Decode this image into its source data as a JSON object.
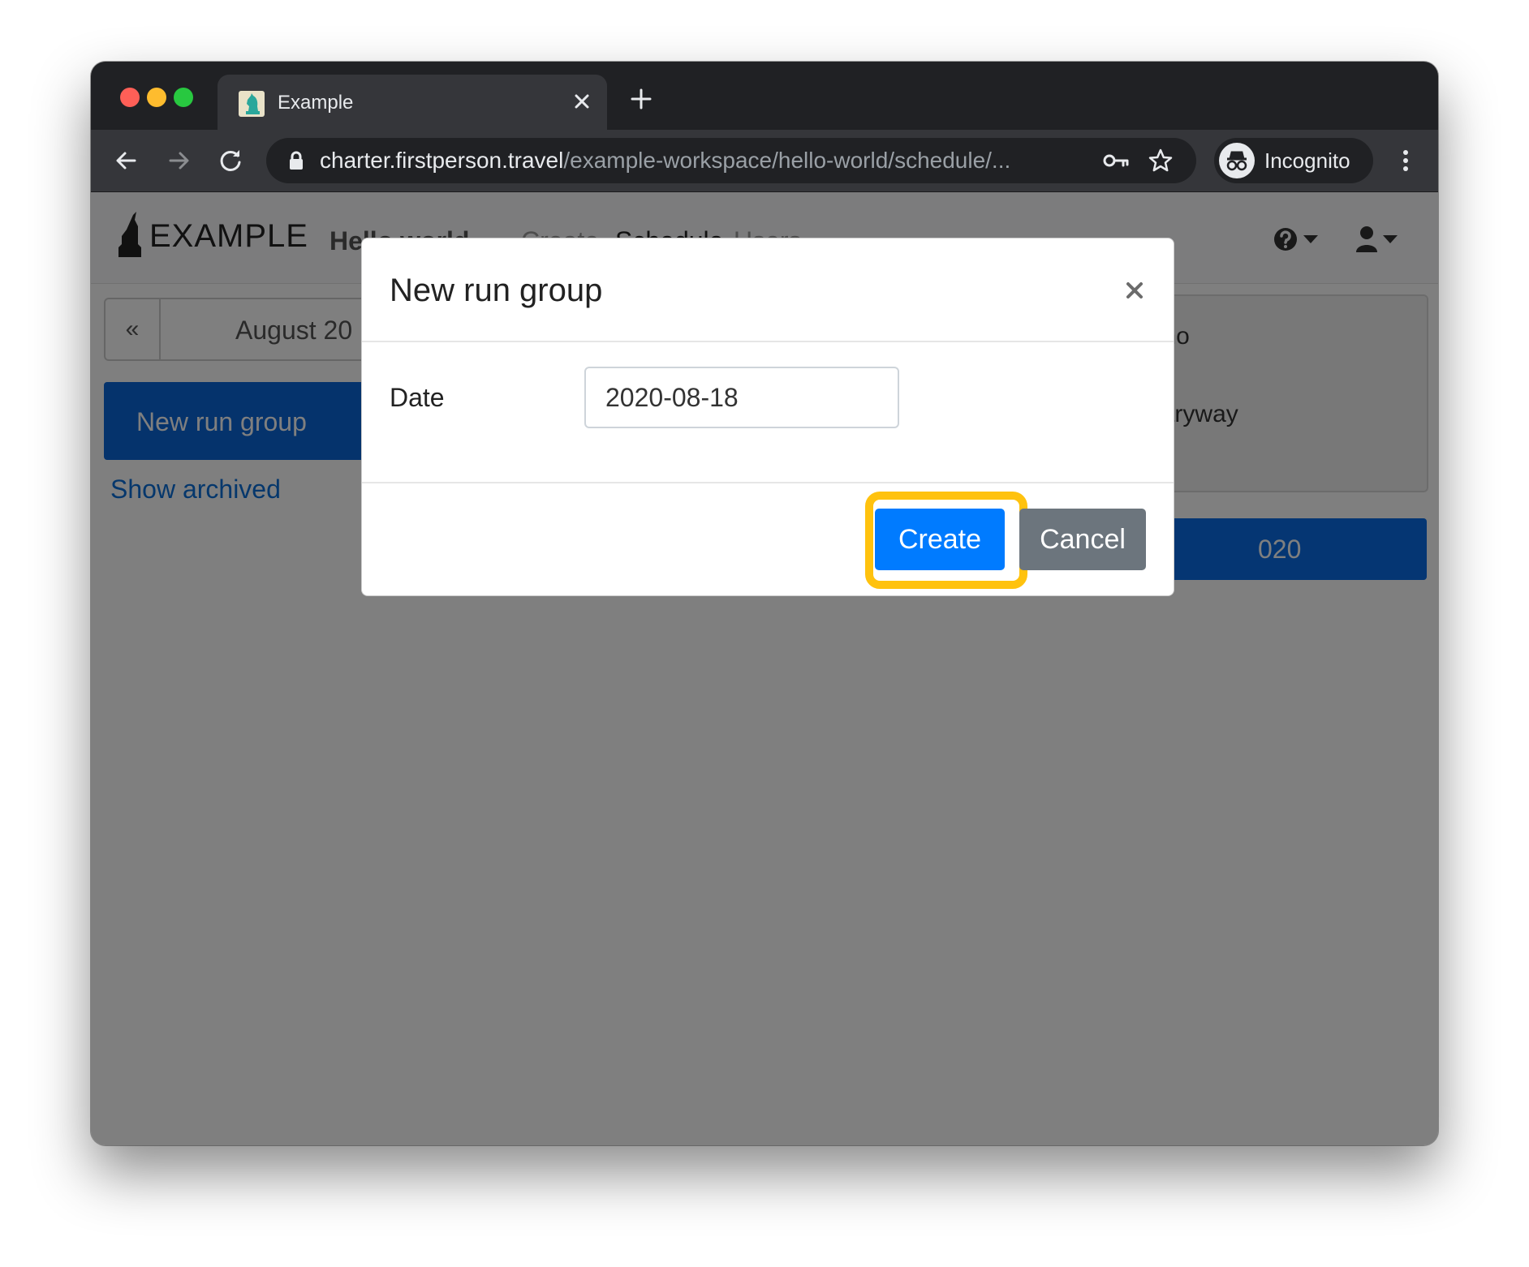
{
  "browser": {
    "tab": {
      "title": "Example",
      "favicon": "chess-knight-favicon"
    },
    "new_tab_icon": "plus-icon",
    "url": {
      "host": "charter.firstperson.travel",
      "path": "/example-workspace/hello-world/schedule/..."
    },
    "profile_label": "Incognito",
    "traffic_light_colors": {
      "close": "#ff5f57",
      "minimize": "#febc2e",
      "zoom": "#28c840"
    }
  },
  "app": {
    "brand": "EXAMPLE",
    "workspace_dropdown": "Hello world",
    "nav": {
      "create": "Create",
      "schedule": "Schedule",
      "users": "Users"
    },
    "calendar": {
      "prev_label": "«",
      "month": "August 20"
    },
    "new_run_group_button": "New run group",
    "show_archived_link": "Show archived",
    "side_panel": {
      "line1": "cause no",
      "line2": "se no entryway"
    },
    "side_bar_text": "020"
  },
  "modal": {
    "title": "New run group",
    "close_label": "×",
    "date_label": "Date",
    "date_value": "2020-08-18",
    "create_button": "Create",
    "cancel_button": "Cancel"
  },
  "colors": {
    "primary": "#007bff",
    "secondary": "#6c757d",
    "highlight": "#ffc20e",
    "chat": "#fcbd3c"
  }
}
